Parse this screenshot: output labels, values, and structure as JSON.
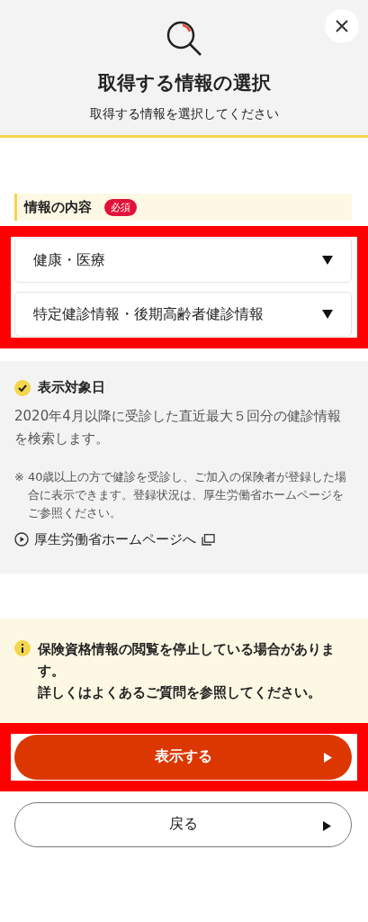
{
  "header": {
    "title": "取得する情報の選択",
    "subtitle": "取得する情報を選択してください"
  },
  "field": {
    "label": "情報の内容",
    "badge": "必須",
    "highlighted": true,
    "selects": [
      {
        "value": "健康・医療"
      },
      {
        "value": "特定健診情報・後期高齢者健診情報"
      }
    ]
  },
  "info": {
    "heading": "表示対象日",
    "text": "2020年4月以降に受診した直近最大５回分の健診情報を検索します。",
    "note_mark": "※",
    "note": "40歳以上の方で健診を受診し、ご加入の保険者が登録した場合に表示できます。登録状況は、厚生労働省ホームページをご参照ください。",
    "link": "厚生労働省ホームページへ"
  },
  "notice": {
    "lines": [
      "保険資格情報の閲覧を停止している場合があります。",
      "詳しくはよくあるご質問を参照してください。"
    ]
  },
  "buttons": [
    {
      "label": "表示する",
      "kind": "primary",
      "highlighted": true
    },
    {
      "label": "戻る",
      "kind": "secondary",
      "highlighted": false
    }
  ]
}
